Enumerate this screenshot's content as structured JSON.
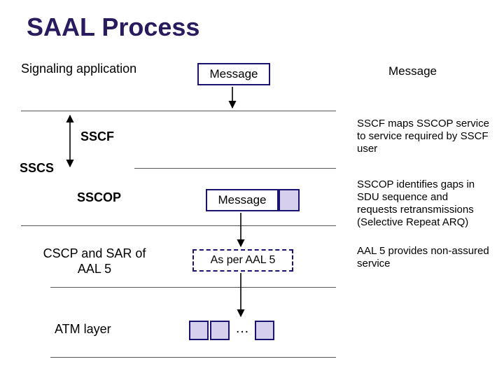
{
  "title": "SAAL Process",
  "labels": {
    "signaling_app": "Signaling application",
    "sscf": "SSCF",
    "sscs": "SSCS",
    "sscop": "SSCOP",
    "cscp_sar": "CSCP and SAR of AAL 5",
    "atm": "ATM layer"
  },
  "boxes": {
    "msg_top": "Message",
    "msg_mid": "Message",
    "asper": "As per AAL 5"
  },
  "right": {
    "msg_header": "Message",
    "sscf_desc": "SSCF maps SSCOP service to service required by SSCF user",
    "sscop_desc": "SSCOP identifies gaps in SDU sequence and requests retransmissions (Selective Repeat ARQ)",
    "aal5_desc": "AAL 5 provides non-assured service"
  },
  "ellipsis": "…"
}
